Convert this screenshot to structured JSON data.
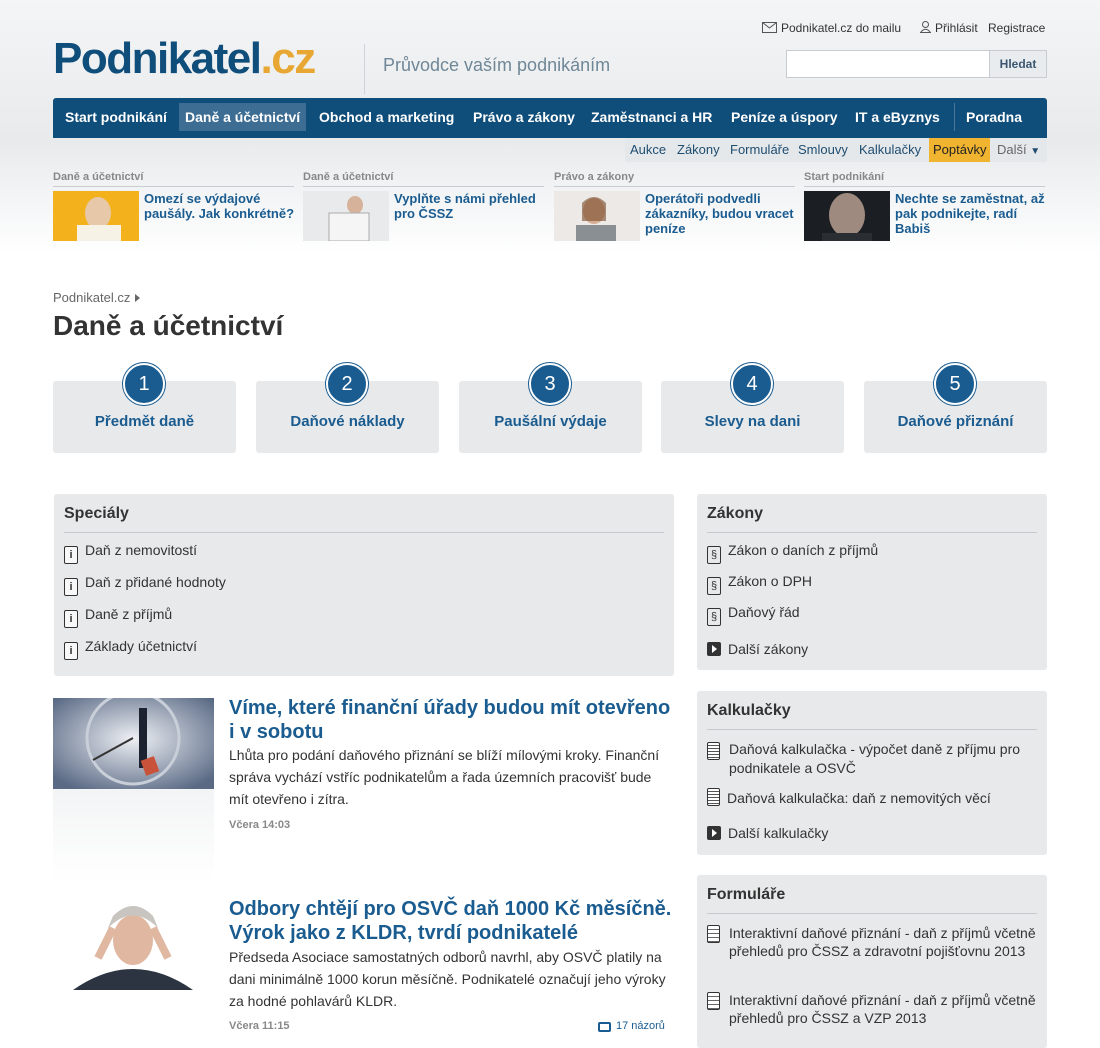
{
  "header": {
    "logo_main": "Podnikatel",
    "logo_tld": ".cz",
    "tagline": "Průvodce vaším podnikáním",
    "mail_link": "Podnikatel.cz do mailu",
    "login": "Přihlásit",
    "register": "Registrace",
    "search_placeholder": "",
    "search_button": "Hledat"
  },
  "nav": {
    "items": [
      "Start podnikání",
      "Daně a účetnictví",
      "Obchod a marketing",
      "Právo a zákony",
      "Zaměstnanci a HR",
      "Peníze a úspory",
      "IT a eByznys",
      "Poradna"
    ],
    "active": "Daně a účetnictví"
  },
  "subnav": {
    "items": [
      "Aukce",
      "Zákony",
      "Formuláře",
      "Smlouvy",
      "Kalkulačky",
      "Poptávky",
      "Další"
    ],
    "highlighted": "Poptávky"
  },
  "promos": [
    {
      "category": "Daně a účetnictví",
      "title": "Omezí se výdajové paušály. Jak konkrétně?"
    },
    {
      "category": "Daně a účetnictví",
      "title": "Vyplňte s námi přehled pro ČSSZ"
    },
    {
      "category": "Právo a zákony",
      "title": "Operátoři podvedli zákazníky, budou vracet peníze"
    },
    {
      "category": "Start podnikání",
      "title": "Nechte se zaměstnat, až pak podnikejte, radí Babiš"
    }
  ],
  "breadcrumb": "Podnikatel.cz",
  "page_title": "Daně a účetnictví",
  "steps": [
    {
      "num": "1",
      "label": "Předmět daně"
    },
    {
      "num": "2",
      "label": "Daňové náklady"
    },
    {
      "num": "3",
      "label": "Paušální výdaje"
    },
    {
      "num": "4",
      "label": "Slevy na dani"
    },
    {
      "num": "5",
      "label": "Daňové přiznání"
    }
  ],
  "specialy": {
    "title": "Speciály",
    "items": [
      "Daň z nemovitostí",
      "Daň z přidané hodnoty",
      "Daně z příjmů",
      "Základy účetnictví"
    ]
  },
  "zakony": {
    "title": "Zákony",
    "items": [
      "Zákon o daních z příjmů",
      "Zákon o DPH",
      "Daňový řád"
    ],
    "more": "Další zákony"
  },
  "kalkulacky": {
    "title": "Kalkulačky",
    "items": [
      "Daňová kalkulačka - výpočet daně z příjmu pro podnikatele a OSVČ",
      "Daňová kalkulačka: daň z nemovitých věcí"
    ],
    "more": "Další kalkulačky"
  },
  "formulare": {
    "title": "Formuláře",
    "items": [
      "Interaktivní daňové přiznání - daň z příjmů včetně přehledů pro ČSSZ a zdravotní pojišťovnu 2013",
      "Interaktivní daňové přiznání - daň z příjmů včetně přehledů pro ČSSZ a VZP 2013"
    ]
  },
  "articles": [
    {
      "title": "Víme, které finanční úřady budou mít otevřeno i v sobotu",
      "text": "Lhůta pro podání daňového přiznání se blíží mílovými kroky. Finanční správa vychází vstříc podnikatelům a řada územních pracovišť bude mít otevřeno i zítra.",
      "time": "Včera 14:03"
    },
    {
      "title": "Odbory chtějí pro OSVČ daň 1000 Kč měsíčně. Výrok jako z KLDR, tvrdí podnikatelé",
      "text": "Předseda Asociace samostatných odborů navrhl, aby OSVČ platily na dani minimálně 1000 korun měsíčně. Podnikatelé označují jeho výroky za hodné pohlavárů KLDR.",
      "time": "Včera 11:15",
      "comments": "17 názorů"
    }
  ]
}
